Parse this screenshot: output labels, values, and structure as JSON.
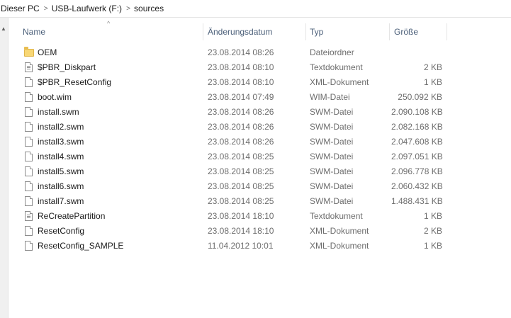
{
  "breadcrumb": {
    "items": [
      "Dieser PC",
      "USB-Laufwerk (F:)",
      "sources"
    ],
    "separator": ">"
  },
  "columns": {
    "name": "Name",
    "date": "Änderungsdatum",
    "type": "Typ",
    "size": "Größe",
    "sort_indicator": "^"
  },
  "files": [
    {
      "name": "OEM",
      "date": "23.08.2014 08:26",
      "type": "Dateiordner",
      "size": "",
      "icon": "folder-icon"
    },
    {
      "name": "$PBR_Diskpart",
      "date": "23.08.2014 08:10",
      "type": "Textdokument",
      "size": "2 KB",
      "icon": "text-file-icon"
    },
    {
      "name": "$PBR_ResetConfig",
      "date": "23.08.2014 08:10",
      "type": "XML-Dokument",
      "size": "1 KB",
      "icon": "file-icon"
    },
    {
      "name": "boot.wim",
      "date": "23.08.2014 07:49",
      "type": "WIM-Datei",
      "size": "250.092 KB",
      "icon": "file-icon"
    },
    {
      "name": "install.swm",
      "date": "23.08.2014 08:26",
      "type": "SWM-Datei",
      "size": "2.090.108 KB",
      "icon": "file-icon"
    },
    {
      "name": "install2.swm",
      "date": "23.08.2014 08:26",
      "type": "SWM-Datei",
      "size": "2.082.168 KB",
      "icon": "file-icon"
    },
    {
      "name": "install3.swm",
      "date": "23.08.2014 08:26",
      "type": "SWM-Datei",
      "size": "2.047.608 KB",
      "icon": "file-icon"
    },
    {
      "name": "install4.swm",
      "date": "23.08.2014 08:25",
      "type": "SWM-Datei",
      "size": "2.097.051 KB",
      "icon": "file-icon"
    },
    {
      "name": "install5.swm",
      "date": "23.08.2014 08:25",
      "type": "SWM-Datei",
      "size": "2.096.778 KB",
      "icon": "file-icon"
    },
    {
      "name": "install6.swm",
      "date": "23.08.2014 08:25",
      "type": "SWM-Datei",
      "size": "2.060.432 KB",
      "icon": "file-icon"
    },
    {
      "name": "install7.swm",
      "date": "23.08.2014 08:25",
      "type": "SWM-Datei",
      "size": "1.488.431 KB",
      "icon": "file-icon"
    },
    {
      "name": "ReCreatePartition",
      "date": "23.08.2014 18:10",
      "type": "Textdokument",
      "size": "1 KB",
      "icon": "text-file-icon"
    },
    {
      "name": "ResetConfig",
      "date": "23.08.2014 18:10",
      "type": "XML-Dokument",
      "size": "2 KB",
      "icon": "file-icon"
    },
    {
      "name": "ResetConfig_SAMPLE",
      "date": "11.04.2012 10:01",
      "type": "XML-Dokument",
      "size": "1 KB",
      "icon": "file-icon"
    }
  ],
  "colors": {
    "header_text": "#4c607a",
    "secondary_text": "#6d6d6d",
    "folder": "#f8d775"
  }
}
